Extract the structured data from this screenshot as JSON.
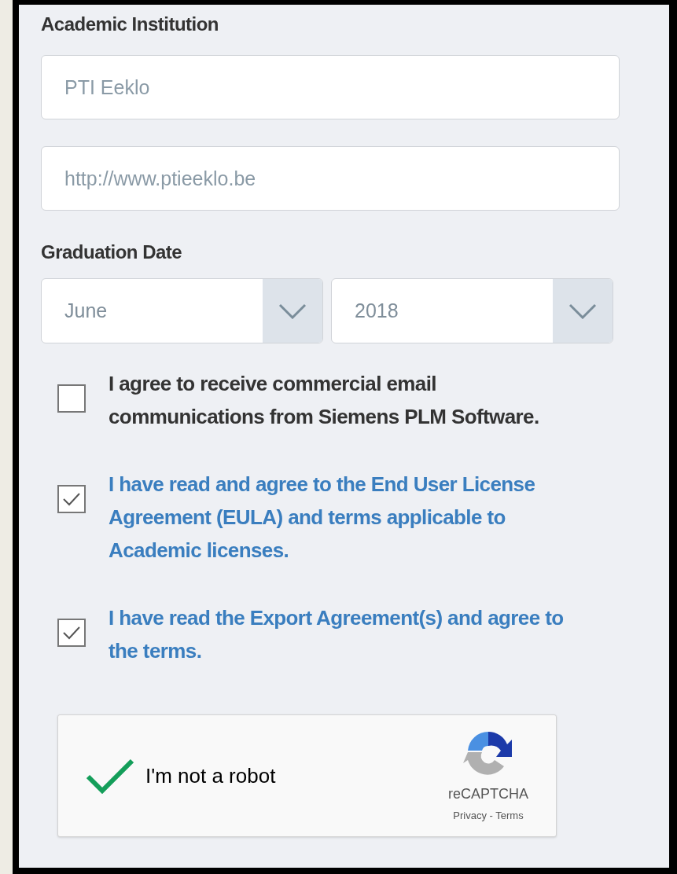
{
  "institution": {
    "label": "Academic Institution",
    "fields": [
      {
        "placeholder": "PTI Eeklo"
      },
      {
        "placeholder": "http://www.ptieeklo.be"
      }
    ]
  },
  "graduation": {
    "label": "Graduation Date",
    "selects": [
      {
        "value": "June"
      },
      {
        "value": "2018"
      }
    ]
  },
  "agreements": [
    {
      "kind": "plain",
      "checked": false,
      "text": "I agree to receive commercial email communications from Siemens PLM Software."
    },
    {
      "kind": "link",
      "checked": true,
      "text": "I have read and agree to the End User License Agreement (EULA) and terms applicable to Academic licenses."
    },
    {
      "kind": "link",
      "checked": true,
      "text": "I have read the Export Agreement(s) and agree to the terms."
    }
  ],
  "captcha": {
    "checked": true,
    "label": "I'm not a robot",
    "brand": "reCAPTCHA",
    "links": "Privacy - Terms"
  }
}
